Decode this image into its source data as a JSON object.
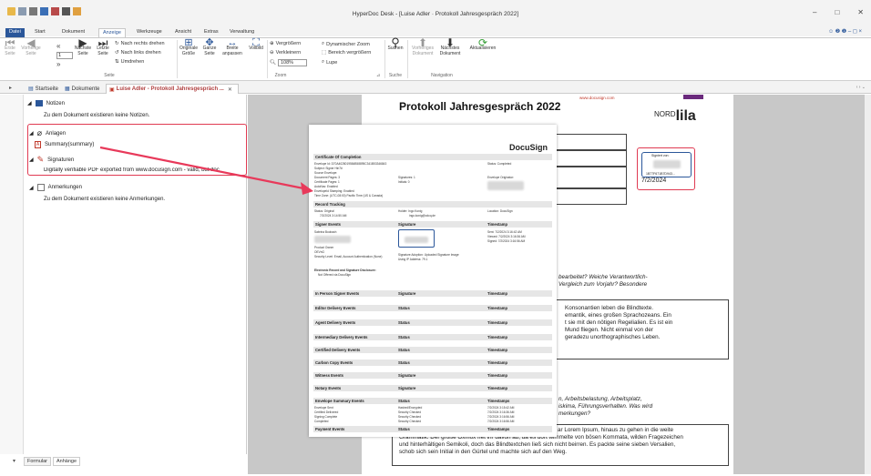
{
  "window": {
    "title": "HyperDoc Desk - [Luise Adler · Protokoll Jahresgespräch 2022]",
    "controls": [
      "–",
      "□",
      "✕"
    ]
  },
  "menu": {
    "file": "Datei",
    "tabs": [
      "Start",
      "Dokument",
      "Anzeige",
      "Werkzeuge",
      "Ansicht",
      "Extras",
      "Verwaltung"
    ]
  },
  "ribbon": {
    "page_group": {
      "label": "Seite",
      "first": "Erste\nSeite",
      "prev": "Vorherige\nSeite",
      "page_value": "1",
      "next": "Nächste\nSeite",
      "last": "Letzte\nSeite",
      "rotate_right": "Nach rechts drehen",
      "rotate_left": "Nach links drehen",
      "flip": "Umdrehen"
    },
    "view_group": {
      "original": "Originale\nGröße",
      "whole": "Ganze\nSeite",
      "width": "Breite\nanpassen",
      "fullscreen": "Vollbild"
    },
    "zoom_group": {
      "label": "Zoom",
      "in": "Vergrößern",
      "out": "Verkleinern",
      "value": "108%",
      "dynamic": "Dynamischer Zoom",
      "area": "Bereich vergrößern",
      "loupe": "Lupe"
    },
    "search_group": {
      "label": "Suche",
      "search": "Suchen"
    },
    "nav_group": {
      "label": "Navigation",
      "prev_doc": "Vorheriges\nDokument",
      "next_doc": "Nächstes\nDokument",
      "refresh": "Aktualisieren"
    }
  },
  "doc_tabs": [
    {
      "label": "Startseite"
    },
    {
      "label": "Dokumente"
    },
    {
      "label": "Luise Adler - Protokoll Jahresgespräch ..."
    }
  ],
  "tree": {
    "notes": "Notizen",
    "notes_empty": "Zu dem Dokument existieren keine Notizen.",
    "attachments": "Anlagen",
    "summary": "Summary(summary)",
    "signatures": "Signaturen",
    "signature_info": "Digitally verifiable PDF exported from www.docusign.com - valid, but doc",
    "annotations": "Anmerkungen",
    "annotations_empty": "Zu dem Dokument existieren keine Anmerkungen."
  },
  "bottom_tabs": [
    "Formular",
    "Anhänge"
  ],
  "document": {
    "title": "Protokoll Jahresgespräch 2022",
    "url": "www.docusign.com",
    "logo_top": "NORD",
    "logo_main": "lila",
    "signed_label": "Signiert von:",
    "signed_id": "1B77F671B7D943...",
    "signed_date": "7/2/2024",
    "q1": "bearbeitet? Weiche Verantwortlich-",
    "q2": "Vergleich zum Vorjahr? Besondere",
    "p1": [
      "Konsonantien leben die Blindtexte.",
      "emantik, eines großen Sprachozeans. Ein",
      "t sie mit den nötigen Regelialien. Es ist ein",
      "Mund fliegen. Nicht einmal von der",
      "geradezu unorthographisches Leben."
    ],
    "q3": [
      "n, Arbeitsbelastung, Arbeitsplatz,",
      "iskima, Führungsverhalten. Was wird",
      "merkungen?"
    ],
    "p2": [
      "ar Lorem Ipsum, hinaus zu gehen in die weite",
      "Grammatik. Der große Oxmox riet ihr davon ab, da es dort wimmelte von bösen Kommata, wilden Fragezeichen",
      "und hinterhältigen Semikoli, doch das Blindtextchen ließ sich nicht beirren. Es packte seine sieben Versalien,",
      "schob sich sein Initial in den Gürtel und machte sich auf den Weg."
    ]
  },
  "certificate": {
    "brand": "DocuSign",
    "heading": "Certificate Of Completion",
    "lines": [
      "Envelope Id: D70A4028019584B58895C341B53346843",
      "Subject: Signer Hin7#",
      "Source Envelope:",
      "Document Pages: 3",
      "Certificate Pages: 1",
      "AutoNav: Enabled",
      "EnvelopeId Stamping: Enabled",
      "Time Zone: (UTC-08:00) Pacific Time (US & Canada)"
    ],
    "col2": [
      "Signatures: 1",
      "Initials: 0"
    ],
    "status": "Status: Completed",
    "originator": "Envelope Originator:",
    "record": "Record Tracking",
    "record_status": "Status: Original",
    "record_date": "7/2/2024 3:14:50 AM",
    "holder": "Holder: Ingo Konig",
    "holder_mail": "ingo.konig@cdcq.de",
    "location": "Location: DocuSign",
    "signer_events": [
      "Signer Events",
      "Signature",
      "Timestamp"
    ],
    "signer_name": "Sabrina Boobach",
    "signer_role": "Product Owner",
    "signer_org": "OEVnG",
    "signer_sec": "Security Level: Email, Account Authentication (None)",
    "sig_adopt": "Signature Adoption: Uploaded Signature Image",
    "sig_ip": "Using IP Address: 79.1",
    "sent": "Sent: 7/2/2024 3:16:42 AM",
    "viewed": "Viewed: 7/2/2024 3:16:36 AM",
    "signed": "Signed: 7/2/2024 3:16:56 AM",
    "erecord": "Electronic Record and Signature Disclosure:",
    "erecord2": "Not Offered via DocuSign",
    "sections": [
      [
        "In Person Signer Events",
        "Signature",
        "Timestamp"
      ],
      [
        "Editor Delivery Events",
        "Status",
        "Timestamp"
      ],
      [
        "Agent Delivery Events",
        "Status",
        "Timestamp"
      ],
      [
        "Intermediary Delivery Events",
        "Status",
        "Timestamp"
      ],
      [
        "Certified Delivery Events",
        "Status",
        "Timestamp"
      ],
      [
        "Carbon Copy Events",
        "Status",
        "Timestamp"
      ],
      [
        "Witness Events",
        "Signature",
        "Timestamp"
      ],
      [
        "Notary Events",
        "Signature",
        "Timestamp"
      ],
      [
        "Envelope Summary Events",
        "Status",
        "Timestamps"
      ]
    ],
    "summary_rows": [
      [
        "Envelope Sent",
        "Hashed/Encrypted",
        "7/2/2024 3:15:42 AM"
      ],
      [
        "Certified Delivered",
        "Security Checked",
        "7/2/2024 3:16:36 AM"
      ],
      [
        "Signing Complete",
        "Security Checked",
        "7/2/2024 3:16:56 AM"
      ],
      [
        "Completed",
        "Security Checked",
        "7/2/2024 3:16:56 AM"
      ]
    ],
    "payment": [
      "Payment Events",
      "Status",
      "Timestamps"
    ]
  },
  "colors": {
    "accent": "#2b579a",
    "highlight": "#e03a52",
    "logo": "#6b2a7d"
  }
}
